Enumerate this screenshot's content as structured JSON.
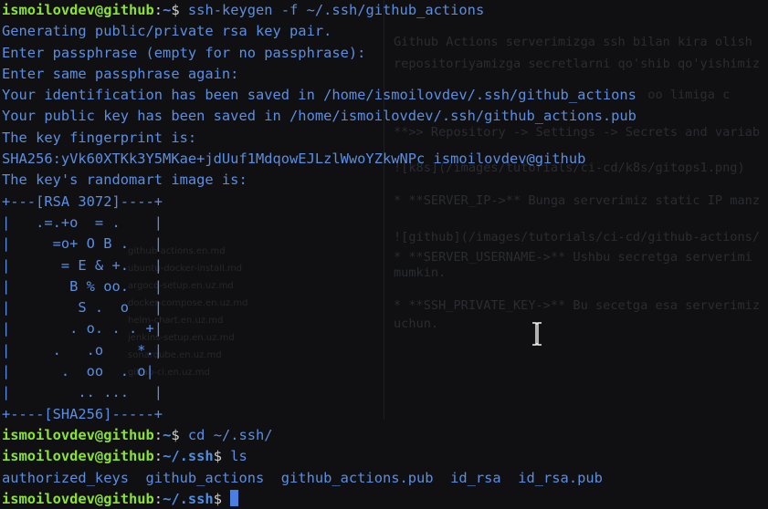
{
  "terminal": {
    "user_host": "ismoilovdev@github",
    "colon": ":",
    "lines": [
      {
        "kind": "prompt",
        "path": "~",
        "suffix": "$",
        "command": " ssh-keygen -f ~/.ssh/github_actions"
      },
      {
        "kind": "out",
        "text": "Generating public/private rsa key pair."
      },
      {
        "kind": "out",
        "text": "Enter passphrase (empty for no passphrase):"
      },
      {
        "kind": "out",
        "text": "Enter same passphrase again:"
      },
      {
        "kind": "out",
        "text": "Your identification has been saved in /home/ismoilovdev/.ssh/github_actions"
      },
      {
        "kind": "out",
        "text": "Your public key has been saved in /home/ismoilovdev/.ssh/github_actions.pub"
      },
      {
        "kind": "out",
        "text": "The key fingerprint is:"
      },
      {
        "kind": "out",
        "text": "SHA256:yVk60XTKk3Y5MKae+jdUuf1MdqowEJLzlWwoYZkwNPc ismoilovdev@github"
      },
      {
        "kind": "out",
        "text": "The key's randomart image is:"
      },
      {
        "kind": "out",
        "text": "+---[RSA 3072]----+"
      },
      {
        "kind": "out",
        "text": "|   .=.+o  = .    |"
      },
      {
        "kind": "out",
        "text": "|     =o+ O B .   |"
      },
      {
        "kind": "out",
        "text": "|      = E & +.   |"
      },
      {
        "kind": "out",
        "text": "|       B % oo.   |"
      },
      {
        "kind": "out",
        "text": "|        S .  o   |"
      },
      {
        "kind": "out",
        "text": "|       . o. . . +|"
      },
      {
        "kind": "out",
        "text": "|     .   .o    *.|"
      },
      {
        "kind": "out",
        "text": "|      .  oo  . o|"
      },
      {
        "kind": "out",
        "text": "|        .. ...   |"
      },
      {
        "kind": "out",
        "text": "+----[SHA256]-----+"
      },
      {
        "kind": "prompt",
        "path": "~",
        "suffix": "$",
        "command": " cd ~/.ssh/"
      },
      {
        "kind": "prompt",
        "path": "~/.ssh",
        "suffix": "$",
        "command": " ls"
      },
      {
        "kind": "out",
        "text": "authorized_keys  github_actions  github_actions.pub  id_rsa  id_rsa.pub"
      },
      {
        "kind": "prompt_cursor",
        "path": "~/.ssh",
        "suffix": "$",
        "command": " "
      }
    ]
  },
  "background_editor": {
    "lines": [
      {
        "text": "Github Actions serverimizga ssh bilan kira olish"
      },
      {
        "text": "repositoriyamizga secretlarni qo'shib qo'yishimiz"
      },
      {
        "text": "                                  oo limiga c"
      },
      {
        "text": "**>> Repository -> Settings -> Secrets and variab"
      },
      {
        "text": "![k8s](/images/tutorials/ci-cd/k8s/gitops1.png)"
      },
      {
        "text": "* **SERVER_IP->** Bunga serverimiz static IP manz"
      },
      {
        "text": "![github](/images/tutorials/ci-cd/github-actions/"
      },
      {
        "text": "* **SERVER_USERNAME->** Ushbu secretga serverimi"
      },
      {
        "text": "mumkin."
      },
      {
        "text": "* **SSH_PRIVATE_KEY->** Bu secetga esa serverimiz"
      },
      {
        "text": "uchun."
      }
    ],
    "files": [
      {
        "text": "github-actions.en.md"
      },
      {
        "text": "ubuntu-docker-install.md"
      },
      {
        "text": "argocd-setup.en.uz.md"
      },
      {
        "text": "docker-compose.en.uz.md"
      },
      {
        "text": "helm-chart.en.uz.md"
      },
      {
        "text": "jenkins-setup.en.uz.md"
      },
      {
        "text": "sonarqube.en.uz.md"
      },
      {
        "text": "gitlab-ci.en.uz.md"
      }
    ]
  },
  "colors": {
    "background": "#101012",
    "user_host": "#8ae234",
    "path": "#4d8fe6",
    "text": "#5a8ee3",
    "cursor": "#4a7fe0"
  }
}
